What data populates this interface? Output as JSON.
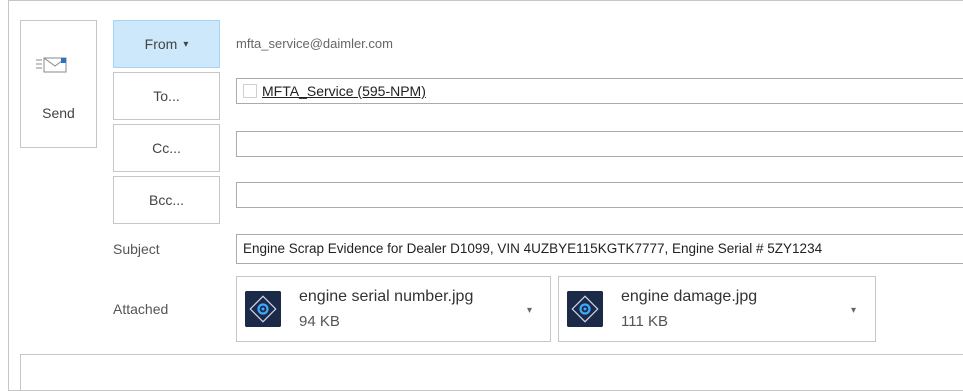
{
  "send": {
    "label": "Send",
    "icon": "send-envelope-icon"
  },
  "headers": {
    "from_label": "From",
    "from_caret": "▾",
    "from_address": "mfta_service@daimler.com",
    "to_label": "To...",
    "cc_label": "Cc...",
    "bcc_label": "Bcc..."
  },
  "to": {
    "recipient": "MFTA_Service (595-NPM)"
  },
  "cc": {
    "value": ""
  },
  "bcc": {
    "value": ""
  },
  "subject": {
    "label": "Subject",
    "value": "Engine Scrap Evidence for Dealer D1099, VIN 4UZBYE115KGTK7777, Engine Serial # 5ZY1234"
  },
  "attachments": {
    "label": "Attached",
    "items": [
      {
        "name": "engine serial number.jpg",
        "size": "94 KB",
        "icon": "photoshop-file-icon"
      },
      {
        "name": "engine damage.jpg",
        "size": "111 KB",
        "icon": "photoshop-file-icon"
      }
    ]
  },
  "colors": {
    "from_button_bg": "#cde8fa",
    "border": "#c6c6c6",
    "icon_bg": "#1c2a4a",
    "icon_accent": "#3ea8ff"
  }
}
